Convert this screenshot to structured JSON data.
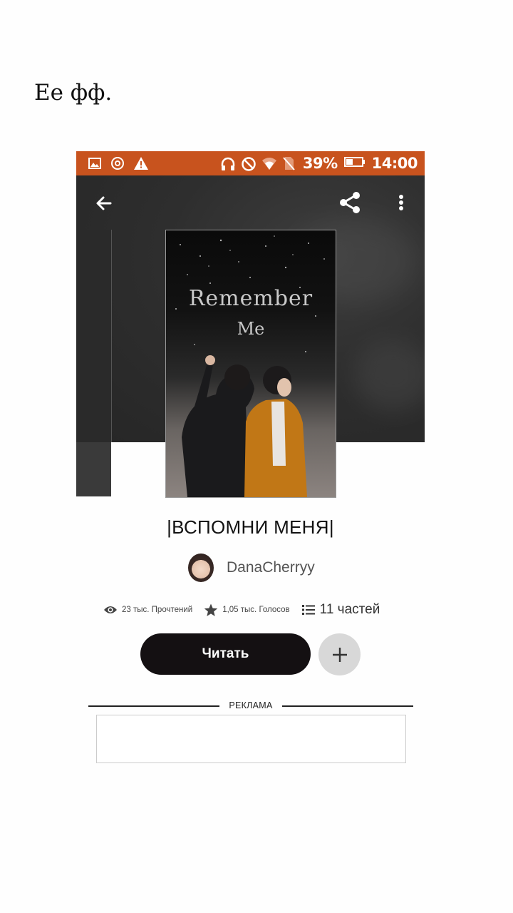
{
  "caption": "Ее фф.",
  "status_bar": {
    "battery": "39%",
    "time": "14:00",
    "background": "#c8531e"
  },
  "toolbar": {
    "back_icon": "arrow-left-icon",
    "share_icon": "share-icon",
    "more_icon": "more-vertical-icon"
  },
  "cover": {
    "title": "Remember",
    "subtitle": "Me"
  },
  "book": {
    "title": "|ВСПОМНИ МЕНЯ|",
    "author": "DanaCherryy"
  },
  "stats": {
    "reads": "23 тыс. Прочтений",
    "votes": "1,05 тыс. Голосов",
    "parts": "11 частей"
  },
  "actions": {
    "read_label": "Читать",
    "add_icon": "plus-icon"
  },
  "ad": {
    "label": "РЕКЛАМА"
  }
}
